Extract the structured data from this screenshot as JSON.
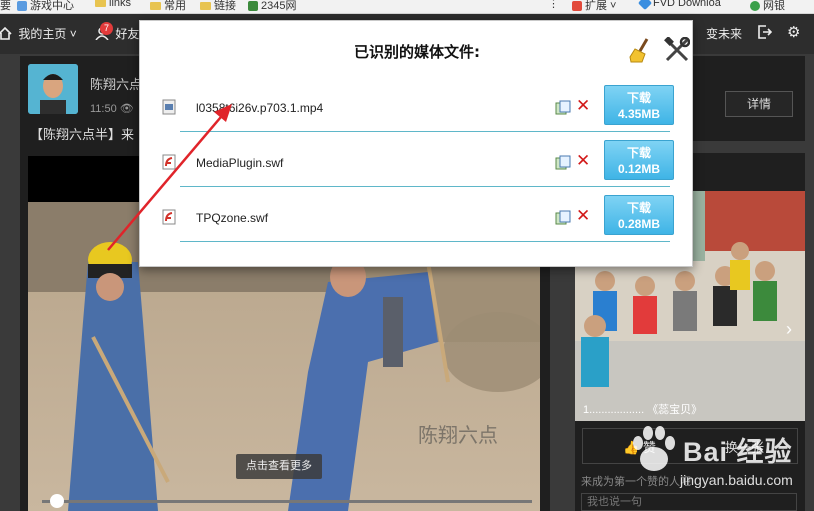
{
  "bookmarks": {
    "items": [
      {
        "label": "游戏中心"
      },
      {
        "label": "links"
      },
      {
        "label": "常用"
      },
      {
        "label": "链接"
      },
      {
        "label": "2345网"
      }
    ],
    "extensions": [
      {
        "label": "扩展"
      },
      {
        "label": "FVD Downloa"
      },
      {
        "label": "网银"
      }
    ]
  },
  "nav": {
    "home": "我的主页",
    "friends": "好友",
    "friends_badge": "7",
    "user": "变未来"
  },
  "post": {
    "author": "陈翔六点",
    "time": "11:50",
    "title": "【陈翔六点半】来",
    "view_more": "点击查看更多"
  },
  "sidebar": {
    "detail_button": "详情",
    "caption": "1.................. 《蕊宝贝》",
    "like_button": "赞",
    "swap_button": "换一张",
    "comment_prompt": "来成为第一个赞的人吧",
    "comment_placeholder": "我也说一句"
  },
  "popup": {
    "title": "已识别的媒体文件:",
    "download_label": "下载",
    "files": [
      {
        "name": "l0358t6i26v.p703.1.mp4",
        "size": "4.35MB",
        "type": "video"
      },
      {
        "name": "MediaPlugin.swf",
        "size": "0.12MB",
        "type": "flash"
      },
      {
        "name": "TPQzone.swf",
        "size": "0.28MB",
        "type": "flash"
      }
    ]
  },
  "watermark": {
    "brand": "Bai 经验",
    "url": "jingyan.baidu.com"
  },
  "colors": {
    "download_button": "#4fbbe9",
    "delete_x": "#d21919",
    "row_divider": "#5fb7c9",
    "arrow": "#e0242a"
  }
}
